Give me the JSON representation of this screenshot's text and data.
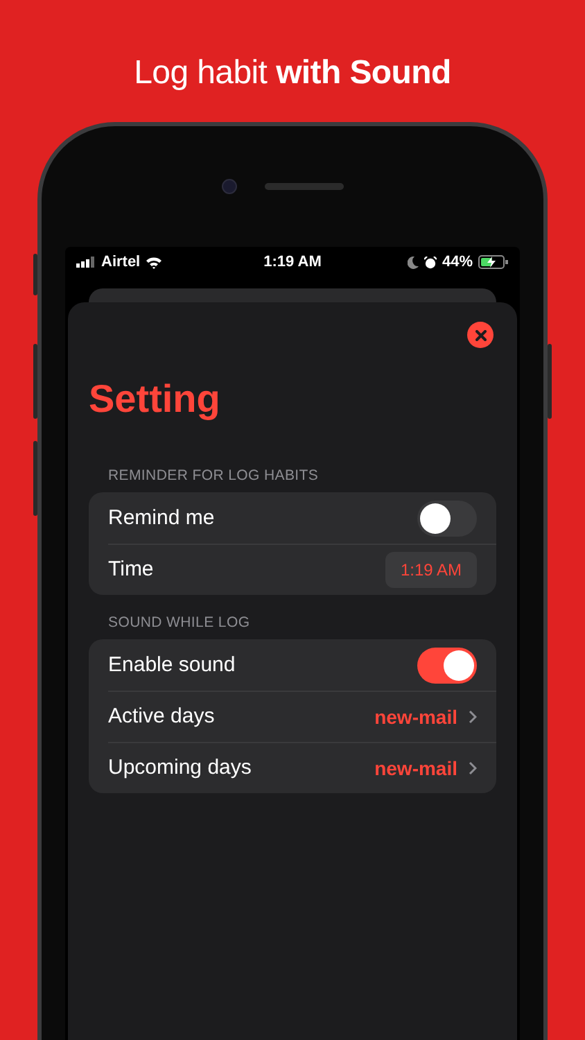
{
  "headline": "Log habit **with Sound**",
  "status_bar": {
    "carrier": "Airtel",
    "time": "1:19 AM",
    "battery": "44%"
  },
  "title": "Setting",
  "sections": [
    {
      "header": "REMINDER FOR LOG HABITS",
      "rows": [
        {
          "kind": "toggle",
          "label": "Remind me",
          "on": false
        },
        {
          "kind": "time",
          "label": "Time",
          "value": "1:19 AM"
        }
      ]
    },
    {
      "header": "SOUND WHILE LOG",
      "rows": [
        {
          "kind": "toggle",
          "label": "Enable sound",
          "on": true
        },
        {
          "kind": "link",
          "label": "Active days",
          "value": "new-mail"
        },
        {
          "kind": "link",
          "label": "Upcoming days",
          "value": "new-mail"
        }
      ]
    }
  ]
}
